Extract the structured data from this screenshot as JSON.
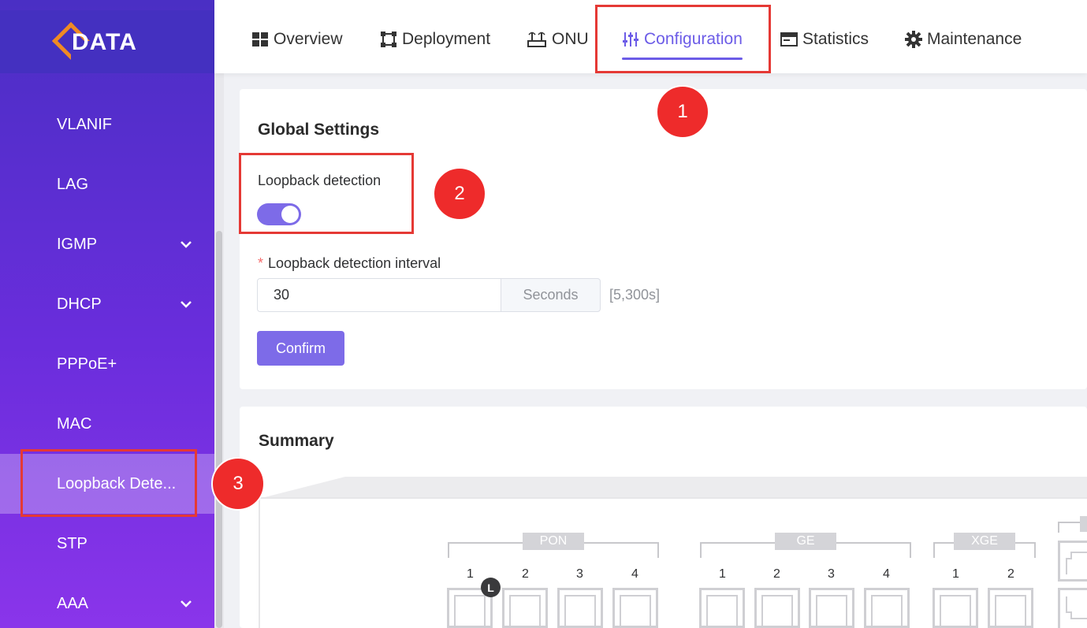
{
  "brand": {
    "logo_text": "DATA",
    "accent": "#6c5ce7",
    "sidebar_top": "#4a2fc4",
    "sidebar_bottom": "#8a35ea"
  },
  "nav": {
    "tabs": [
      {
        "label": "Overview",
        "icon": "grid-icon"
      },
      {
        "label": "Deployment",
        "icon": "deployment-icon"
      },
      {
        "label": "ONU",
        "icon": "router-icon"
      },
      {
        "label": "Configuration",
        "icon": "sliders-icon",
        "active": true
      },
      {
        "label": "Statistics",
        "icon": "window-icon"
      },
      {
        "label": "Maintenance",
        "icon": "gear-icon"
      }
    ]
  },
  "sidebar": {
    "items": [
      {
        "label": "VLANIF"
      },
      {
        "label": "LAG"
      },
      {
        "label": "IGMP",
        "expandable": true
      },
      {
        "label": "DHCP",
        "expandable": true
      },
      {
        "label": "PPPoE+"
      },
      {
        "label": "MAC"
      },
      {
        "label": "Loopback Dete...",
        "active": true
      },
      {
        "label": "STP"
      },
      {
        "label": "AAA",
        "expandable": true
      }
    ]
  },
  "global": {
    "title": "Global Settings",
    "toggle_label": "Loopback detection",
    "toggle_on": true,
    "required_mark": "*",
    "interval_label": "Loopback detection interval",
    "interval_value": "30",
    "unit": "Seconds",
    "range": "[5,300s]",
    "confirm": "Confirm"
  },
  "summary": {
    "title": "Summary",
    "groups": [
      {
        "label": "PON",
        "ports": [
          "1",
          "2",
          "3",
          "4"
        ]
      },
      {
        "label": "GE",
        "ports": [
          "1",
          "2",
          "3",
          "4"
        ]
      },
      {
        "label": "XGE",
        "ports": [
          "1",
          "2"
        ]
      }
    ],
    "loop_badge": "L"
  },
  "annotations": [
    "1",
    "2",
    "3"
  ]
}
